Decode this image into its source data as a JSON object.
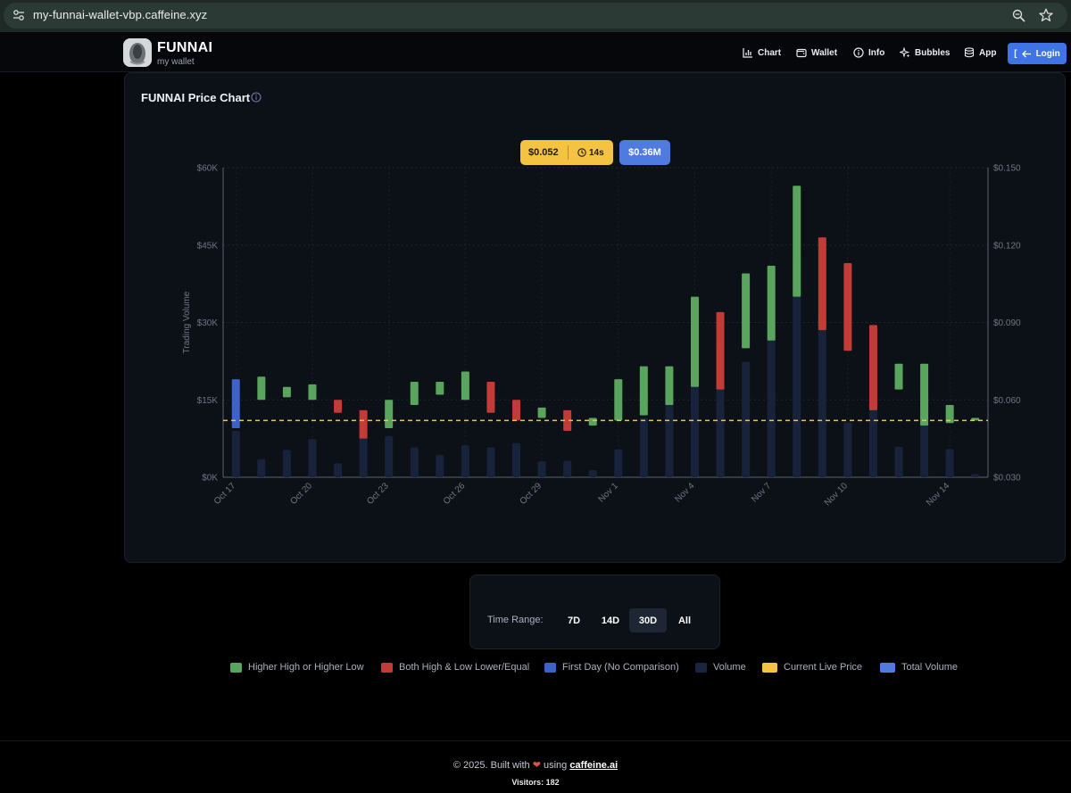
{
  "browser": {
    "url": "my-funnai-wallet-vbp.caffeine.xyz",
    "icons": [
      "site-settings-icon",
      "zoom-icon",
      "bookmark-star-icon"
    ]
  },
  "header": {
    "brand": "FUNNAI",
    "subtitle": "my wallet",
    "nav": [
      {
        "label": "Chart",
        "icon": "bar-chart-icon"
      },
      {
        "label": "Wallet",
        "icon": "wallet-icon"
      },
      {
        "label": "Info",
        "icon": "info-icon"
      },
      {
        "label": "Bubbles",
        "icon": "sparkle-icon"
      },
      {
        "label": "App",
        "icon": "database-icon"
      }
    ],
    "login": {
      "label": "Login",
      "prefix": "[",
      "icon": "arrow-left-icon"
    }
  },
  "chart_card": {
    "title": "FUNNAI Price Chart",
    "live_price": "$0.052",
    "refresh": "14s",
    "total_volume": "$0.36M"
  },
  "chart_data": {
    "type": "candlestick_volume",
    "left_axis": {
      "label": "Trading Volume",
      "ticks": [
        "$0K",
        "$15K",
        "$30K",
        "$45K",
        "$60K"
      ],
      "range": [
        0,
        60000
      ]
    },
    "right_axis": {
      "ticks": [
        "$0.030",
        "$0.060",
        "$0.090",
        "$0.120",
        "$0.150"
      ],
      "range": [
        0.03,
        0.15
      ]
    },
    "x_ticks": [
      "Oct 17",
      "Oct 20",
      "Oct 23",
      "Oct 26",
      "Oct 29",
      "Nov 1",
      "Nov 4",
      "Nov 7",
      "Nov 10",
      "Nov 14"
    ],
    "days": [
      "Oct 17",
      "Oct 18",
      "Oct 19",
      "Oct 20",
      "Oct 21",
      "Oct 22",
      "Oct 23",
      "Oct 24",
      "Oct 25",
      "Oct 26",
      "Oct 27",
      "Oct 28",
      "Oct 29",
      "Oct 30",
      "Oct 31",
      "Nov 1",
      "Nov 2",
      "Nov 3",
      "Nov 4",
      "Nov 5",
      "Nov 6",
      "Nov 7",
      "Nov 8",
      "Nov 9",
      "Nov 10",
      "Nov 11",
      "Nov 12",
      "Nov 13",
      "Nov 14",
      "Nov 15"
    ],
    "candles": [
      {
        "low": 0.049,
        "high": 0.068,
        "kind": "first"
      },
      {
        "low": 0.06,
        "high": 0.069,
        "kind": "higher"
      },
      {
        "low": 0.061,
        "high": 0.065,
        "kind": "higher"
      },
      {
        "low": 0.06,
        "high": 0.066,
        "kind": "higher"
      },
      {
        "low": 0.055,
        "high": 0.06,
        "kind": "lower"
      },
      {
        "low": 0.045,
        "high": 0.056,
        "kind": "lower"
      },
      {
        "low": 0.049,
        "high": 0.06,
        "kind": "higher"
      },
      {
        "low": 0.058,
        "high": 0.067,
        "kind": "higher"
      },
      {
        "low": 0.062,
        "high": 0.067,
        "kind": "higher"
      },
      {
        "low": 0.06,
        "high": 0.071,
        "kind": "higher"
      },
      {
        "low": 0.055,
        "high": 0.067,
        "kind": "lower"
      },
      {
        "low": 0.052,
        "high": 0.06,
        "kind": "lower"
      },
      {
        "low": 0.053,
        "high": 0.057,
        "kind": "higher"
      },
      {
        "low": 0.048,
        "high": 0.056,
        "kind": "lower"
      },
      {
        "low": 0.05,
        "high": 0.053,
        "kind": "higher"
      },
      {
        "low": 0.052,
        "high": 0.068,
        "kind": "higher"
      },
      {
        "low": 0.054,
        "high": 0.073,
        "kind": "higher"
      },
      {
        "low": 0.058,
        "high": 0.073,
        "kind": "higher"
      },
      {
        "low": 0.065,
        "high": 0.1,
        "kind": "higher"
      },
      {
        "low": 0.064,
        "high": 0.094,
        "kind": "lower"
      },
      {
        "low": 0.08,
        "high": 0.109,
        "kind": "higher"
      },
      {
        "low": 0.083,
        "high": 0.112,
        "kind": "higher"
      },
      {
        "low": 0.1,
        "high": 0.143,
        "kind": "higher"
      },
      {
        "low": 0.087,
        "high": 0.123,
        "kind": "lower"
      },
      {
        "low": 0.079,
        "high": 0.113,
        "kind": "lower"
      },
      {
        "low": 0.056,
        "high": 0.089,
        "kind": "lower"
      },
      {
        "low": 0.064,
        "high": 0.074,
        "kind": "higher"
      },
      {
        "low": 0.05,
        "high": 0.074,
        "kind": "higher"
      },
      {
        "low": 0.051,
        "high": 0.058,
        "kind": "higher"
      },
      {
        "low": 0.052,
        "high": 0.053,
        "kind": "higher"
      }
    ],
    "volume": [
      9000,
      3500,
      5300,
      7400,
      2700,
      8000,
      8000,
      5800,
      4300,
      6200,
      5800,
      6600,
      3100,
      3200,
      1400,
      5400,
      11500,
      17500,
      27700,
      25000,
      22400,
      36000,
      42000,
      31500,
      10600,
      14300,
      5900,
      17000,
      5500,
      600
    ],
    "live_price_line": 0.052
  },
  "time_range": {
    "label": "Time Range:",
    "options": [
      "7D",
      "14D",
      "30D",
      "All"
    ],
    "selected": "30D"
  },
  "legend": [
    {
      "label": "Higher High or Higher Low",
      "color": "#5aa55d"
    },
    {
      "label": "Both High & Low Lower/Equal",
      "color": "#c23b36"
    },
    {
      "label": "First Day (No Comparison)",
      "color": "#3d62c9"
    },
    {
      "label": "Volume",
      "color": "#1a2540"
    },
    {
      "label": "Current Live Price",
      "color": "#f5c342"
    },
    {
      "label": "Total Volume",
      "color": "#4f7be0"
    }
  ],
  "footer": {
    "copyright": "© 2025. Built with",
    "using": "using",
    "link": "caffeine.ai",
    "visitors": "Visitors: 182"
  }
}
